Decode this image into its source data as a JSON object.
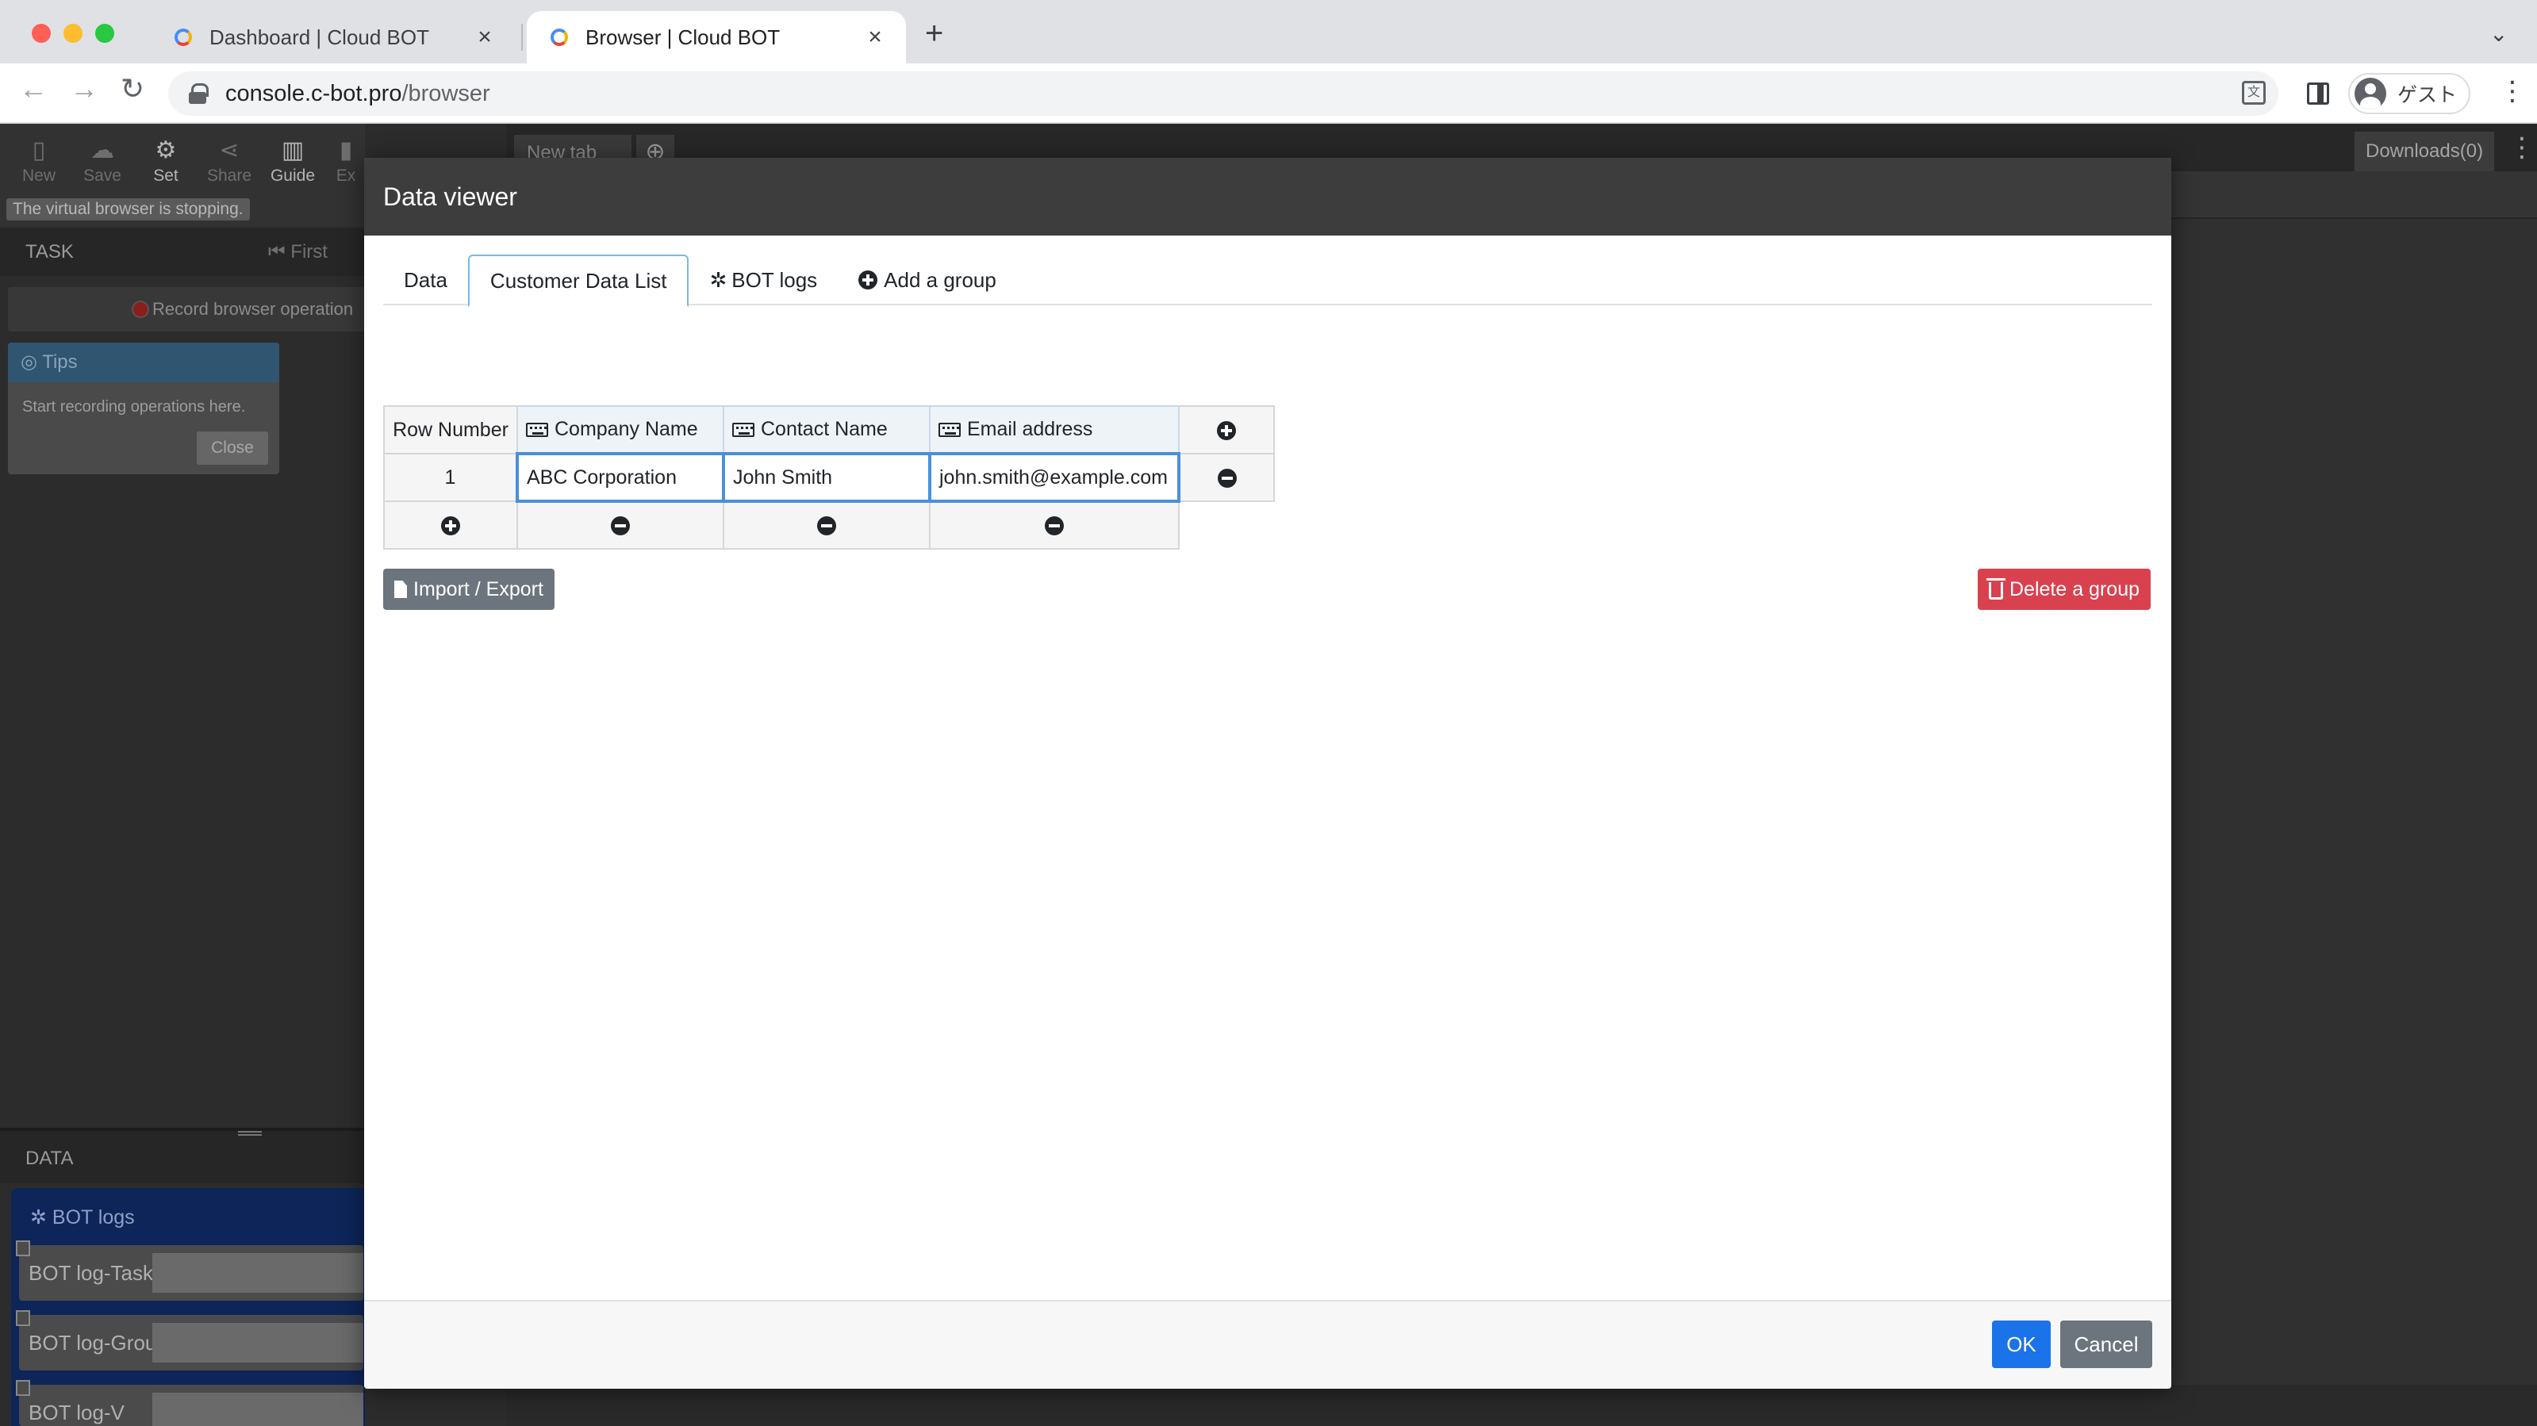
{
  "browser": {
    "tabs": [
      {
        "title": "Dashboard | Cloud BOT"
      },
      {
        "title": "Browser | Cloud BOT"
      }
    ],
    "url_host": "console.c-bot.pro",
    "url_path": "/browser",
    "profile_name": "ゲスト"
  },
  "app": {
    "toolbar": {
      "new": "New",
      "save": "Save",
      "set": "Set",
      "share": "Share",
      "guide": "Guide",
      "exit": "Ex"
    },
    "status": "The virtual browser is stopping.",
    "task_header": "TASK",
    "task_nav_first": "First",
    "record_label": "Record browser operation",
    "tips": {
      "title": "Tips",
      "body": "Start recording operations here.",
      "close": "Close"
    },
    "data_header": "DATA",
    "bot_logs": {
      "title": "BOT logs",
      "rows": [
        "BOT log-Task",
        "BOT log-Grou",
        "BOT log-V"
      ]
    },
    "browser_tab": "New tab",
    "downloads": "Downloads(0)"
  },
  "modal": {
    "title": "Data viewer",
    "tabs": {
      "data": "Data",
      "customer": "Customer Data List",
      "bot_logs": "BOT logs",
      "add_group": "Add a group"
    },
    "table": {
      "row_number_header": "Row Number",
      "columns": [
        "Company Name",
        "Contact Name",
        "Email address"
      ],
      "rows": [
        {
          "row": "1",
          "company": "ABC Corporation",
          "contact": "John Smith",
          "email": "john.smith@example.com"
        }
      ]
    },
    "import_export": "Import / Export",
    "delete_group": "Delete a group",
    "ok": "OK",
    "cancel": "Cancel"
  },
  "colors": {
    "primary": "#1a73e8",
    "danger": "#d9414f",
    "secondary": "#6c757d",
    "modal_header": "#3d3d3d",
    "active_tab_border": "#7ab8e6"
  }
}
